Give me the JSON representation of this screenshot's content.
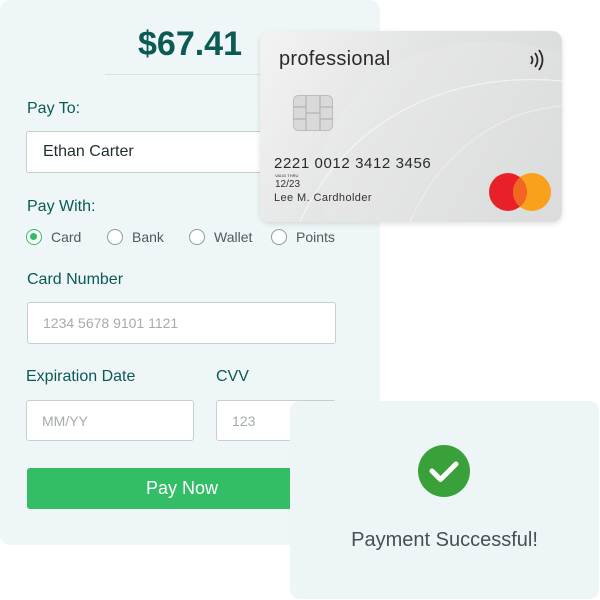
{
  "payment": {
    "amount": "$67.41",
    "pay_to_label": "Pay To:",
    "pay_to_value": "Ethan Carter",
    "pay_with_label": "Pay With:",
    "methods": [
      {
        "label": "Card",
        "selected": true
      },
      {
        "label": "Bank",
        "selected": false
      },
      {
        "label": "Wallet",
        "selected": false
      },
      {
        "label": "Points",
        "selected": false
      }
    ],
    "card_number_label": "Card Number",
    "card_number_placeholder": "1234 5678 9101 1121",
    "expiration_label": "Expiration Date",
    "expiration_placeholder": "MM/YY",
    "cvv_label": "CVV",
    "cvv_placeholder": "123",
    "pay_button_label": "Pay Now"
  },
  "card": {
    "brand_text": "professional",
    "number": "2221 0012 3412 3456",
    "valid_thru_label": "VALID THRU",
    "expiry": "12/23",
    "holder": "Lee M. Cardholder",
    "network_logo": "mastercard-logo",
    "contactless_icon": "contactless-icon"
  },
  "success": {
    "icon": "check-circle-icon",
    "message": "Payment Successful!"
  },
  "colors": {
    "accent_green": "#33bd66",
    "heading_teal": "#0b5a53",
    "panel_bg": "#eef6f7"
  }
}
